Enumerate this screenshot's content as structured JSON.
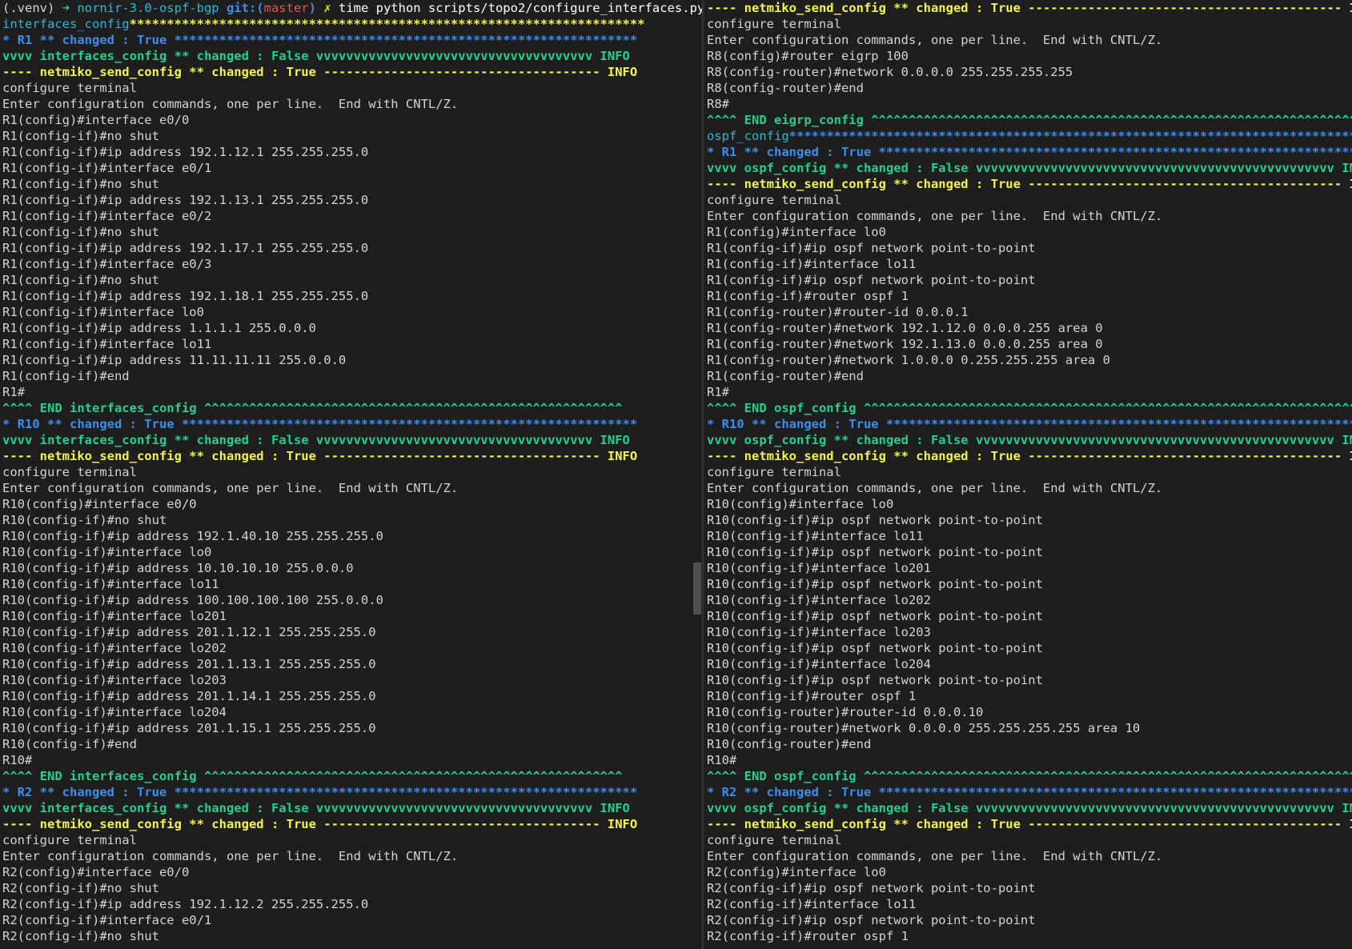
{
  "left": [
    [
      [
        "(.venv) ",
        "white"
      ],
      [
        "➜ ",
        "green"
      ],
      [
        "nornir-3.0-ospf-bgp ",
        "cyan"
      ],
      [
        "git:(",
        "blue"
      ],
      [
        "master",
        "red"
      ],
      [
        ")",
        "blue"
      ],
      [
        " ✗",
        "yellowr"
      ],
      [
        " time python scripts/topo2/configure_interfaces.py",
        "bwhite"
      ]
    ],
    [
      [
        "interfaces_config",
        "cyan"
      ],
      [
        "*********************************************************************",
        "yellow"
      ]
    ],
    [
      [
        "* R1 ** changed : True ",
        "blue"
      ],
      [
        "**************************************************************",
        "blue"
      ]
    ],
    [
      [
        "vvvv interfaces_config ** changed : False vvvvvvvvvvvvvvvvvvvvvvvvvvvvvvvvvvvvv INFO",
        "green"
      ]
    ],
    [
      [
        "---- netmiko_send_config ** changed : True ------------------------------------- INFO",
        "yellow"
      ]
    ],
    [
      [
        "configure terminal",
        "white"
      ]
    ],
    [
      [
        "Enter configuration commands, one per line.  End with CNTL/Z.",
        "white"
      ]
    ],
    [
      [
        "R1(config)#interface e0/0",
        "white"
      ]
    ],
    [
      [
        "R1(config-if)#no shut",
        "white"
      ]
    ],
    [
      [
        "R1(config-if)#ip address 192.1.12.1 255.255.255.0",
        "white"
      ]
    ],
    [
      [
        "R1(config-if)#interface e0/1",
        "white"
      ]
    ],
    [
      [
        "R1(config-if)#no shut",
        "white"
      ]
    ],
    [
      [
        "R1(config-if)#ip address 192.1.13.1 255.255.255.0",
        "white"
      ]
    ],
    [
      [
        "R1(config-if)#interface e0/2",
        "white"
      ]
    ],
    [
      [
        "R1(config-if)#no shut",
        "white"
      ]
    ],
    [
      [
        "R1(config-if)#ip address 192.1.17.1 255.255.255.0",
        "white"
      ]
    ],
    [
      [
        "R1(config-if)#interface e0/3",
        "white"
      ]
    ],
    [
      [
        "R1(config-if)#no shut",
        "white"
      ]
    ],
    [
      [
        "R1(config-if)#ip address 192.1.18.1 255.255.255.0",
        "white"
      ]
    ],
    [
      [
        "R1(config-if)#interface lo0",
        "white"
      ]
    ],
    [
      [
        "R1(config-if)#ip address 1.1.1.1 255.0.0.0",
        "white"
      ]
    ],
    [
      [
        "R1(config-if)#interface lo11",
        "white"
      ]
    ],
    [
      [
        "R1(config-if)#ip address 11.11.11.11 255.0.0.0",
        "white"
      ]
    ],
    [
      [
        "R1(config-if)#end",
        "white"
      ]
    ],
    [
      [
        "R1#",
        "white"
      ]
    ],
    [
      [
        "^^^^ END interfaces_config ^^^^^^^^^^^^^^^^^^^^^^^^^^^^^^^^^^^^^^^^^^^^^^^^^^^^^^^^",
        "green"
      ]
    ],
    [
      [
        "* R10 ** changed : True ",
        "blue"
      ],
      [
        "*************************************************************",
        "blue"
      ]
    ],
    [
      [
        "vvvv interfaces_config ** changed : False vvvvvvvvvvvvvvvvvvvvvvvvvvvvvvvvvvvvv INFO",
        "green"
      ]
    ],
    [
      [
        "---- netmiko_send_config ** changed : True ------------------------------------- INFO",
        "yellow"
      ]
    ],
    [
      [
        "configure terminal",
        "white"
      ]
    ],
    [
      [
        "Enter configuration commands, one per line.  End with CNTL/Z.",
        "white"
      ]
    ],
    [
      [
        "R10(config)#interface e0/0",
        "white"
      ]
    ],
    [
      [
        "R10(config-if)#no shut",
        "white"
      ]
    ],
    [
      [
        "R10(config-if)#ip address 192.1.40.10 255.255.255.0",
        "white"
      ]
    ],
    [
      [
        "R10(config-if)#interface lo0",
        "white"
      ]
    ],
    [
      [
        "R10(config-if)#ip address 10.10.10.10 255.0.0.0",
        "white"
      ]
    ],
    [
      [
        "R10(config-if)#interface lo11",
        "white"
      ]
    ],
    [
      [
        "R10(config-if)#ip address 100.100.100.100 255.0.0.0",
        "white"
      ]
    ],
    [
      [
        "R10(config-if)#interface lo201",
        "white"
      ]
    ],
    [
      [
        "R10(config-if)#ip address 201.1.12.1 255.255.255.0",
        "white"
      ]
    ],
    [
      [
        "R10(config-if)#interface lo202",
        "white"
      ]
    ],
    [
      [
        "R10(config-if)#ip address 201.1.13.1 255.255.255.0",
        "white"
      ]
    ],
    [
      [
        "R10(config-if)#interface lo203",
        "white"
      ]
    ],
    [
      [
        "R10(config-if)#ip address 201.1.14.1 255.255.255.0",
        "white"
      ]
    ],
    [
      [
        "R10(config-if)#interface lo204",
        "white"
      ]
    ],
    [
      [
        "R10(config-if)#ip address 201.1.15.1 255.255.255.0",
        "white"
      ]
    ],
    [
      [
        "R10(config-if)#end",
        "white"
      ]
    ],
    [
      [
        "R10#",
        "white"
      ]
    ],
    [
      [
        "^^^^ END interfaces_config ^^^^^^^^^^^^^^^^^^^^^^^^^^^^^^^^^^^^^^^^^^^^^^^^^^^^^^^^",
        "green"
      ]
    ],
    [
      [
        "* R2 ** changed : True ",
        "blue"
      ],
      [
        "**************************************************************",
        "blue"
      ]
    ],
    [
      [
        "vvvv interfaces_config ** changed : False vvvvvvvvvvvvvvvvvvvvvvvvvvvvvvvvvvvvv INFO",
        "green"
      ]
    ],
    [
      [
        "---- netmiko_send_config ** changed : True ------------------------------------- INFO",
        "yellow"
      ]
    ],
    [
      [
        "configure terminal",
        "white"
      ]
    ],
    [
      [
        "Enter configuration commands, one per line.  End with CNTL/Z.",
        "white"
      ]
    ],
    [
      [
        "R2(config)#interface e0/0",
        "white"
      ]
    ],
    [
      [
        "R2(config-if)#no shut",
        "white"
      ]
    ],
    [
      [
        "R2(config-if)#ip address 192.1.12.2 255.255.255.0",
        "white"
      ]
    ],
    [
      [
        "R2(config-if)#interface e0/1",
        "white"
      ]
    ],
    [
      [
        "R2(config-if)#no shut",
        "white"
      ]
    ]
  ],
  "right": [
    [
      [
        "---- netmiko_send_config ** changed : True ------------------------------------------ INFO",
        "yellow"
      ]
    ],
    [
      [
        "configure terminal",
        "white"
      ]
    ],
    [
      [
        "Enter configuration commands, one per line.  End with CNTL/Z.",
        "white"
      ]
    ],
    [
      [
        "R8(config)#router eigrp 100",
        "white"
      ]
    ],
    [
      [
        "R8(config-router)#network 0.0.0.0 255.255.255.255",
        "white"
      ]
    ],
    [
      [
        "R8(config-router)#end",
        "white"
      ]
    ],
    [
      [
        "R8#",
        "white"
      ]
    ],
    [
      [
        "^^^^ END eigrp_config ^^^^^^^^^^^^^^^^^^^^^^^^^^^^^^^^^^^^^^^^^^^^^^^^^^^^^^^^^^^^^^^^^^^^^^^^^",
        "green"
      ]
    ],
    [
      [
        "ospf_config",
        "cyan"
      ],
      [
        "*******************************************************************************",
        "blue"
      ]
    ],
    [
      [
        "* R1 ** changed : True ",
        "blue"
      ],
      [
        "*******************************************************************",
        "blue"
      ]
    ],
    [
      [
        "vvvv ospf_config ** changed : False vvvvvvvvvvvvvvvvvvvvvvvvvvvvvvvvvvvvvvvvvvvvvvvv INFO",
        "green"
      ]
    ],
    [
      [
        "---- netmiko_send_config ** changed : True ------------------------------------------ INFO",
        "yellow"
      ]
    ],
    [
      [
        "configure terminal",
        "white"
      ]
    ],
    [
      [
        "Enter configuration commands, one per line.  End with CNTL/Z.",
        "white"
      ]
    ],
    [
      [
        "R1(config)#interface lo0",
        "white"
      ]
    ],
    [
      [
        "R1(config-if)#ip ospf network point-to-point",
        "white"
      ]
    ],
    [
      [
        "R1(config-if)#interface lo11",
        "white"
      ]
    ],
    [
      [
        "R1(config-if)#ip ospf network point-to-point",
        "white"
      ]
    ],
    [
      [
        "R1(config-if)#router ospf 1",
        "white"
      ]
    ],
    [
      [
        "R1(config-router)#router-id 0.0.0.1",
        "white"
      ]
    ],
    [
      [
        "R1(config-router)#network 192.1.12.0 0.0.0.255 area 0",
        "white"
      ]
    ],
    [
      [
        "R1(config-router)#network 192.1.13.0 0.0.0.255 area 0",
        "white"
      ]
    ],
    [
      [
        "R1(config-router)#network 1.0.0.0 0.255.255.255 area 0",
        "white"
      ]
    ],
    [
      [
        "R1(config-router)#end",
        "white"
      ]
    ],
    [
      [
        "R1#",
        "white"
      ]
    ],
    [
      [
        "^^^^ END ospf_config ^^^^^^^^^^^^^^^^^^^^^^^^^^^^^^^^^^^^^^^^^^^^^^^^^^^^^^^^^^^^^^^^^^^^^^^^^^",
        "green"
      ]
    ],
    [
      [
        "* R10 ** changed : True ",
        "blue"
      ],
      [
        "******************************************************************",
        "blue"
      ]
    ],
    [
      [
        "vvvv ospf_config ** changed : False vvvvvvvvvvvvvvvvvvvvvvvvvvvvvvvvvvvvvvvvvvvvvvvv INFO",
        "green"
      ]
    ],
    [
      [
        "---- netmiko_send_config ** changed : True ------------------------------------------ INFO",
        "yellow"
      ]
    ],
    [
      [
        "configure terminal",
        "white"
      ]
    ],
    [
      [
        "Enter configuration commands, one per line.  End with CNTL/Z.",
        "white"
      ]
    ],
    [
      [
        "R10(config)#interface lo0",
        "white"
      ]
    ],
    [
      [
        "R10(config-if)#ip ospf network point-to-point",
        "white"
      ]
    ],
    [
      [
        "R10(config-if)#interface lo11",
        "white"
      ]
    ],
    [
      [
        "R10(config-if)#ip ospf network point-to-point",
        "white"
      ]
    ],
    [
      [
        "R10(config-if)#interface lo201",
        "white"
      ]
    ],
    [
      [
        "R10(config-if)#ip ospf network point-to-point",
        "white"
      ]
    ],
    [
      [
        "R10(config-if)#interface lo202",
        "white"
      ]
    ],
    [
      [
        "R10(config-if)#ip ospf network point-to-point",
        "white"
      ]
    ],
    [
      [
        "R10(config-if)#interface lo203",
        "white"
      ]
    ],
    [
      [
        "R10(config-if)#ip ospf network point-to-point",
        "white"
      ]
    ],
    [
      [
        "R10(config-if)#interface lo204",
        "white"
      ]
    ],
    [
      [
        "R10(config-if)#ip ospf network point-to-point",
        "white"
      ]
    ],
    [
      [
        "R10(config-if)#router ospf 1",
        "white"
      ]
    ],
    [
      [
        "R10(config-router)#router-id 0.0.0.10",
        "white"
      ]
    ],
    [
      [
        "R10(config-router)#network 0.0.0.0 255.255.255.255 area 10",
        "white"
      ]
    ],
    [
      [
        "R10(config-router)#end",
        "white"
      ]
    ],
    [
      [
        "R10#",
        "white"
      ]
    ],
    [
      [
        "^^^^ END ospf_config ^^^^^^^^^^^^^^^^^^^^^^^^^^^^^^^^^^^^^^^^^^^^^^^^^^^^^^^^^^^^^^^^^^^^^^^^^^",
        "green"
      ]
    ],
    [
      [
        "* R2 ** changed : True ",
        "blue"
      ],
      [
        "*******************************************************************",
        "blue"
      ]
    ],
    [
      [
        "vvvv ospf_config ** changed : False vvvvvvvvvvvvvvvvvvvvvvvvvvvvvvvvvvvvvvvvvvvvvvvv INFO",
        "green"
      ]
    ],
    [
      [
        "---- netmiko_send_config ** changed : True ------------------------------------------ INFO",
        "yellow"
      ]
    ],
    [
      [
        "configure terminal",
        "white"
      ]
    ],
    [
      [
        "Enter configuration commands, one per line.  End with CNTL/Z.",
        "white"
      ]
    ],
    [
      [
        "R2(config)#interface lo0",
        "white"
      ]
    ],
    [
      [
        "R2(config-if)#ip ospf network point-to-point",
        "white"
      ]
    ],
    [
      [
        "R2(config-if)#interface lo11",
        "white"
      ]
    ],
    [
      [
        "R2(config-if)#ip ospf network point-to-point",
        "white"
      ]
    ],
    [
      [
        "R2(config-if)#router ospf 1",
        "white"
      ]
    ]
  ],
  "colors": {
    "background": "#1e1e1e",
    "text": "#d4d4d4",
    "cyan": "#29b8db",
    "blue": "#3b8eea",
    "green": "#23d18b",
    "yellow": "#f5f543",
    "red": "#f14c4c"
  }
}
